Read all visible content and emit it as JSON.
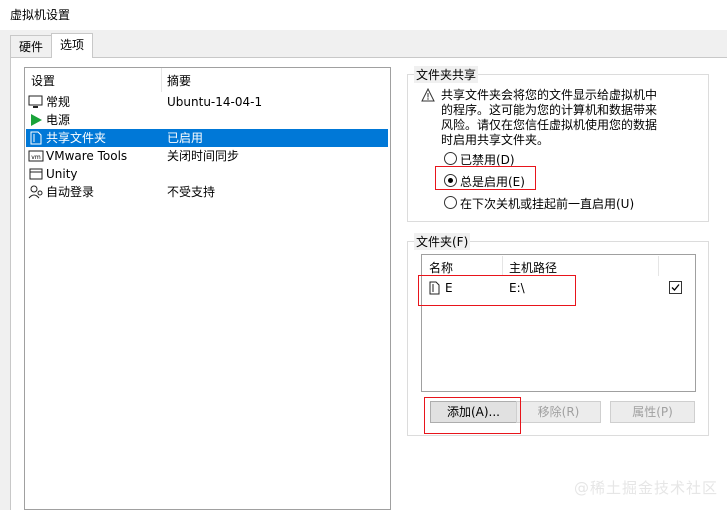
{
  "window": {
    "title": "虚拟机设置"
  },
  "tabs": [
    {
      "label": "硬件"
    },
    {
      "label": "选项"
    }
  ],
  "settings_list": {
    "columns": [
      "设置",
      "摘要"
    ],
    "rows": [
      {
        "label": "常规",
        "summary": "Ubuntu-14-04-1",
        "icon": "monitor-icon"
      },
      {
        "label": "电源",
        "summary": "",
        "icon": "power-play-icon"
      },
      {
        "label": "共享文件夹",
        "summary": "已启用",
        "icon": "shared-folder-icon",
        "selected": true
      },
      {
        "label": "VMware Tools",
        "summary": "关闭时间同步",
        "icon": "vm-icon"
      },
      {
        "label": "Unity",
        "summary": "",
        "icon": "window-icon"
      },
      {
        "label": "自动登录",
        "summary": "不受支持",
        "icon": "user-key-icon"
      }
    ]
  },
  "sharing_group": {
    "title": "文件夹共享",
    "warning_lines": [
      "共享文件夹会将您的文件显示给虚拟机中",
      "的程序。这可能为您的计算机和数据带来",
      "风险。请仅在您信任虚拟机使用您的数据",
      "时启用共享文件夹。"
    ],
    "options": [
      {
        "label": "已禁用(D)",
        "checked": false
      },
      {
        "label": "总是启用(E)",
        "checked": true
      },
      {
        "label": "在下次关机或挂起前一直启用(U)",
        "checked": false
      }
    ]
  },
  "folders_group": {
    "title": "文件夹(F)",
    "columns": [
      "名称",
      "主机路径"
    ],
    "rows": [
      {
        "name": "E",
        "path": "E:\\",
        "enabled": true
      }
    ],
    "buttons": {
      "add": "添加(A)...",
      "remove": "移除(R)",
      "properties": "属性(P)"
    }
  },
  "watermark": "@稀土掘金技术社区",
  "colors": {
    "selection": "#0078d7",
    "annotation": "#e8141b"
  }
}
